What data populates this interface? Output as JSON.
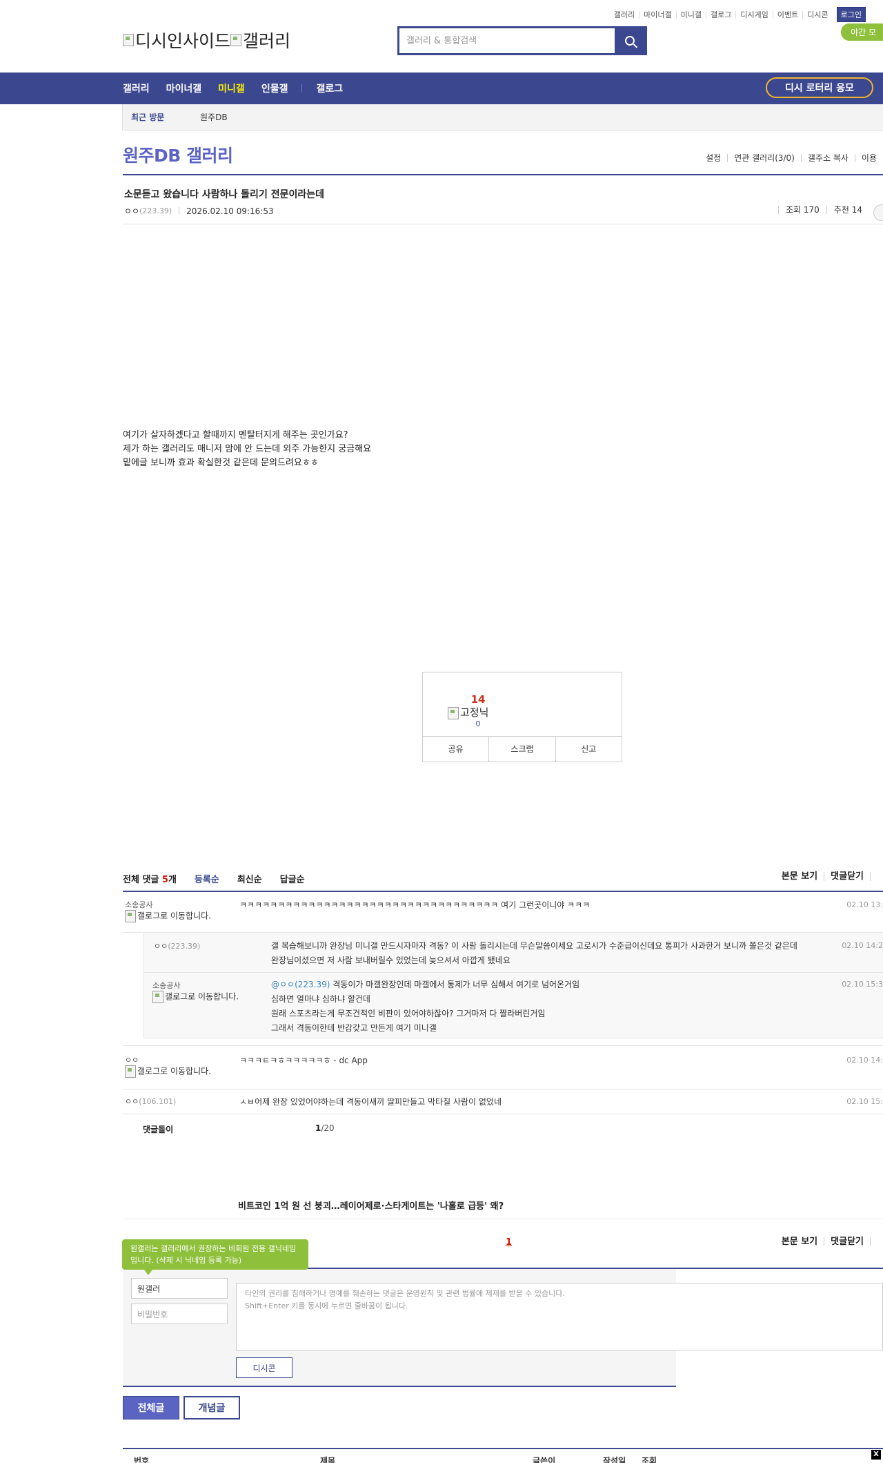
{
  "util": {
    "links": [
      "갤러리",
      "마이너갤",
      "미니갤",
      "갤로그",
      "디시게임",
      "이벤트",
      "디시콘"
    ],
    "login": "로그인",
    "night": "야간 모"
  },
  "header": {
    "logo_alt": "디시인사이드",
    "logo_gallery_alt": "갤러리",
    "search_placeholder": "갤러리 & 통합검색"
  },
  "gnb": {
    "items": [
      "갤러리",
      "마이너갤",
      "미니갤",
      "인물갤"
    ],
    "gallog": "갤로그",
    "lotto": "디시 로터리 응모"
  },
  "recent": {
    "title": "최근 방문",
    "gallery": "원주DB"
  },
  "gallery": {
    "title": "원주DB 갤러리",
    "options": [
      "설정",
      "연관 갤러리(3/0)",
      "갤주소 복사",
      "이용"
    ]
  },
  "post": {
    "title": "소문듣고 왔습니다 사람하나 돌리기 전문이라는데",
    "writer": "ㅇㅇ",
    "ip": "(223.39)",
    "date": "2026.02.10 09:16:53",
    "views": "조회 170",
    "recommends": "추천 14",
    "body": [
      "여기가 살자하겠다고 할때까지 멘탈터지게 해주는 곳인가요?",
      "제가 하는 갤러리도 매니저 맘에 안 드는데 외주 가능한지 궁금해요",
      "밑에글 보니까 효과 확실한것 같은데 문의드려요ㅎㅎ"
    ]
  },
  "recommend_box": {
    "count": "14",
    "fixed_nick_alt": "고정닉",
    "fixed_count": "0",
    "buttons": [
      "공유",
      "스크랩",
      "신고"
    ]
  },
  "comments": {
    "header_prefix": "전체 댓글",
    "count": "5",
    "header_suffix": "개",
    "sort": [
      "등록순",
      "최신순",
      "답글순"
    ],
    "options": [
      "본문 보기",
      "댓글닫기"
    ],
    "items": [
      {
        "writer": "소송공사",
        "img_alt": "갤로그로 이동합니다.",
        "text": "ㅋㅋㅋㅋㅋㅋㅋㅋㅋㅋㅋㅋㅋㅋㅋㅋㅋㅋㅋㅋㅋㅋㅋㅋㅋㅋㅋㅋㅋㅋㅋㅋㅋㅋ 여기 그런곳이니야 ㅋㅋㅋ",
        "date": "02.10 13:"
      },
      {
        "writer": "ㅇㅇ",
        "ip": "(223.39)",
        "text": "갤 복습해보니까 완장님 미니갤 만드시자마자 격동? 이 사람 돌리시는데 무슨말씀이세요 고로시가 수준급이신데요 통피가 사과한거 보니까 쫄은것 같은데 완장님이셨으면 저 사람 보내버릴수 있었는데 늦으셔서 아깝게 됐네요",
        "date": "02.10 14:2"
      },
      {
        "writer": "소송공사",
        "img_alt": "갤로그로 이동합니다.",
        "mention": "@ㅇㅇ(223.39)",
        "lines": [
          "격동이가 마갤완장인데 마갤에서 통제가 너무 심해서 여기로 넘어온거임",
          "심하면 얼마냐 심하냐 할건데",
          "원래 스포츠라는게 무조건적인 비판이 있어야하잖아? 그거마저 다 짤라버린거임",
          "그래서 격동이한테 반감갖고 만든게 여기 미니갤"
        ],
        "date": "02.10 15:3"
      },
      {
        "writer": "ㅇㅇ",
        "img_alt": "갤로그로 이동합니다.",
        "text": "ㅋㅋㅋㅌㅋㅎㅋㅋㅋㅋㅋㅎ - dc App",
        "date": "02.10 14:"
      },
      {
        "writer": "ㅇㅇ",
        "ip": "(106.101)",
        "text": "ㅅㅂ어제 완장 있었어야하는데 격동이새끼 딸피만들고 막타칠 사람이 없었네",
        "date": "02.10 15:"
      }
    ],
    "dolly": "댓글돌이",
    "page_current": "1",
    "page_total": "/20"
  },
  "headline": "비트코인 1억 원 선 붕괴…레이어제로·스타게이트는 '나홀로 급등' 왜?",
  "comment_page": "1",
  "write": {
    "tooltip": "원갤러는 갤러리에서 권장하는 비회원 전용 갤닉네임입니다. (삭제 시 닉네임 등록 가능)",
    "nickname": "원갤러",
    "password_placeholder": "비밀번호",
    "textarea": [
      "타인의 권리를 침해하거나 명예를 훼손하는 댓글은 운영원칙 및 관련 법률에 제재를 받을 수 있습니다.",
      "Shift+Enter 키를 동시에 누르면 줄바꿈이 됩니다."
    ],
    "dccon": "디시콘"
  },
  "list_tabs": [
    "전체글",
    "개념글"
  ],
  "list_header": [
    "번호",
    "제목",
    "글쓴이",
    "작성일",
    "조회"
  ],
  "close": "X"
}
